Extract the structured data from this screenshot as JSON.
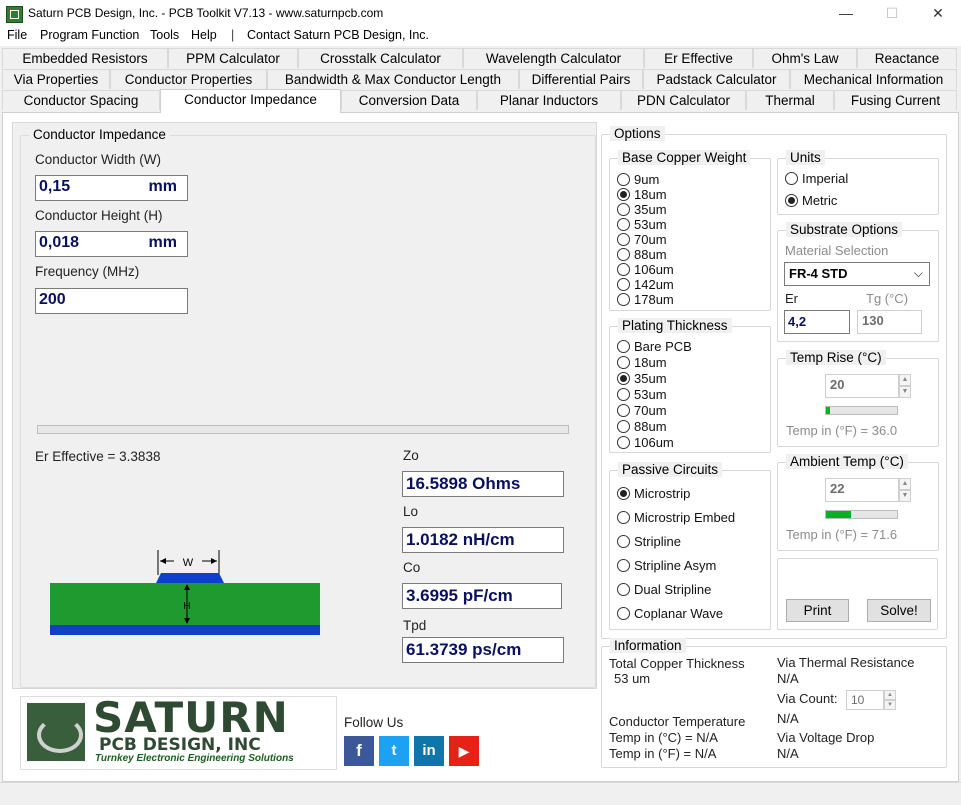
{
  "window": {
    "title": "Saturn PCB Design, Inc. - PCB Toolkit V7.13 - www.saturnpcb.com"
  },
  "menu": [
    "File",
    "Program Function",
    "Tools",
    "Help",
    "|",
    "Contact Saturn PCB Design, Inc."
  ],
  "tabs": {
    "row1": [
      "Embedded Resistors",
      "PPM Calculator",
      "Crosstalk Calculator",
      "Wavelength Calculator",
      "Er Effective",
      "Ohm's Law",
      "Reactance"
    ],
    "row2": [
      "Via Properties",
      "Conductor Properties",
      "Bandwidth & Max Conductor Length",
      "Differential Pairs",
      "Padstack Calculator",
      "Mechanical Information"
    ],
    "row3": [
      "Conductor Spacing",
      "Conductor Impedance",
      "Conversion Data",
      "Planar Inductors",
      "PDN Calculator",
      "Thermal",
      "Fusing Current"
    ]
  },
  "impedance": {
    "group_title": "Conductor Impedance",
    "width_label": "Conductor Width (W)",
    "width_value": "0,15",
    "width_unit": "mm",
    "height_label": "Conductor Height (H)",
    "height_value": "0,018",
    "height_unit": "mm",
    "freq_label": "Frequency (MHz)",
    "freq_value": "200",
    "er_effective": "Er Effective = 3.3838",
    "zo_label": "Zo",
    "zo_value": "16.5898 Ohms",
    "lo_label": "Lo",
    "lo_value": "1.0182 nH/cm",
    "co_label": "Co",
    "co_value": "3.6995 pF/cm",
    "tpd_label": "Tpd",
    "tpd_value": "61.3739 ps/cm",
    "diagram_w": "W",
    "diagram_h": "H"
  },
  "branding": {
    "logo_main": "SATURN",
    "logo_sub": "PCB DESIGN, INC",
    "logo_tag": "Turnkey Electronic Engineering Solutions",
    "follow_us": "Follow Us",
    "social": [
      "f",
      "t",
      "in",
      "▶"
    ]
  },
  "options": {
    "title": "Options",
    "copper": {
      "title": "Base Copper Weight",
      "items": [
        "9um",
        "18um",
        "35um",
        "53um",
        "70um",
        "88um",
        "106um",
        "142um",
        "178um"
      ],
      "selected": 1
    },
    "plating": {
      "title": "Plating Thickness",
      "items": [
        "Bare PCB",
        "18um",
        "35um",
        "53um",
        "70um",
        "88um",
        "106um"
      ],
      "selected": 2
    },
    "passive": {
      "title": "Passive Circuits",
      "items": [
        "Microstrip",
        "Microstrip Embed",
        "Stripline",
        "Stripline Asym",
        "Dual Stripline",
        "Coplanar Wave"
      ],
      "selected": 0
    },
    "units": {
      "title": "Units",
      "items": [
        "Imperial",
        "Metric"
      ],
      "selected": 1
    },
    "substrate": {
      "title": "Substrate Options",
      "material_label": "Material Selection",
      "material_value": "FR-4 STD",
      "er_label": "Er",
      "er_value": "4,2",
      "tg_label": "Tg (°C)",
      "tg_value": "130"
    },
    "temp_rise": {
      "title": "Temp Rise (°C)",
      "value": "20",
      "fraction": 0.05,
      "fahrenheit": "Temp in (°F) = 36.0"
    },
    "ambient": {
      "title": "Ambient Temp (°C)",
      "value": "22",
      "fraction": 0.35,
      "fahrenheit": "Temp in (°F) = 71.6"
    },
    "print_label": "Print",
    "solve_label": "Solve!"
  },
  "information": {
    "title": "Information",
    "copper_label": "Total Copper Thickness",
    "copper_value": "53 um",
    "cond_temp_label": "Conductor Temperature",
    "temp_c": "Temp in (°C) = N/A",
    "temp_f": "Temp in (°F) = N/A",
    "via_thermal_label": "Via Thermal Resistance",
    "via_thermal_value": "N/A",
    "via_count_label": "Via Count:",
    "via_count_value": "10",
    "via_count_result": "N/A",
    "via_drop_label": "Via Voltage Drop",
    "via_drop_value": "N/A"
  },
  "colors": {
    "green": "#1f9a2e",
    "blue": "#1040c8",
    "navy": "#0a1060",
    "youtube": "#e62117",
    "facebook": "#3b5998",
    "twitter": "#1da1f2",
    "linkedin": "#0e76a8"
  }
}
